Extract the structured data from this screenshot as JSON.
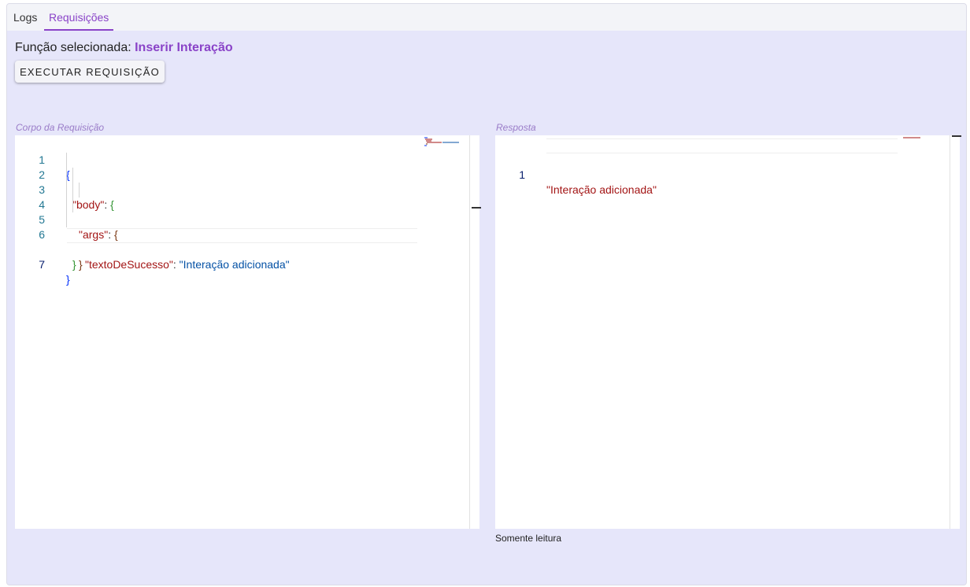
{
  "tabs": [
    {
      "label": "Logs"
    },
    {
      "label": "Requisições"
    }
  ],
  "function_line": {
    "prefix": "Função selecionada:",
    "name": "Inserir Interação"
  },
  "execute_button": {
    "label": "EXECUTAR REQUISIÇÃO"
  },
  "request_panel": {
    "label": "Corpo da Requisição",
    "line_numbers": [
      "1",
      "2",
      "3",
      "4",
      "5",
      "6",
      "7"
    ],
    "lines": [
      {
        "parts": [
          "{"
        ]
      },
      {
        "parts": [
          "\"body\"",
          ": ",
          "{"
        ]
      },
      {
        "parts": [
          "\"args\"",
          ": ",
          "{"
        ]
      },
      {
        "parts": [
          "\"textoDeSucesso\"",
          ": ",
          "\"Interação adicionada\""
        ]
      },
      {
        "parts": [
          "}"
        ]
      },
      {
        "parts": [
          "}"
        ]
      },
      {
        "parts": [
          "}"
        ]
      }
    ]
  },
  "response_panel": {
    "label": "Resposta",
    "line_numbers": [
      "1"
    ],
    "lines": [
      {
        "parts": [
          "\"Interação adicionada\""
        ]
      }
    ],
    "footer": "Somente leitura"
  },
  "colors": {
    "accent": "#8a43c8",
    "background": "#e6e6fa",
    "json_key": "#a31515",
    "json_string": "#0451a5"
  }
}
